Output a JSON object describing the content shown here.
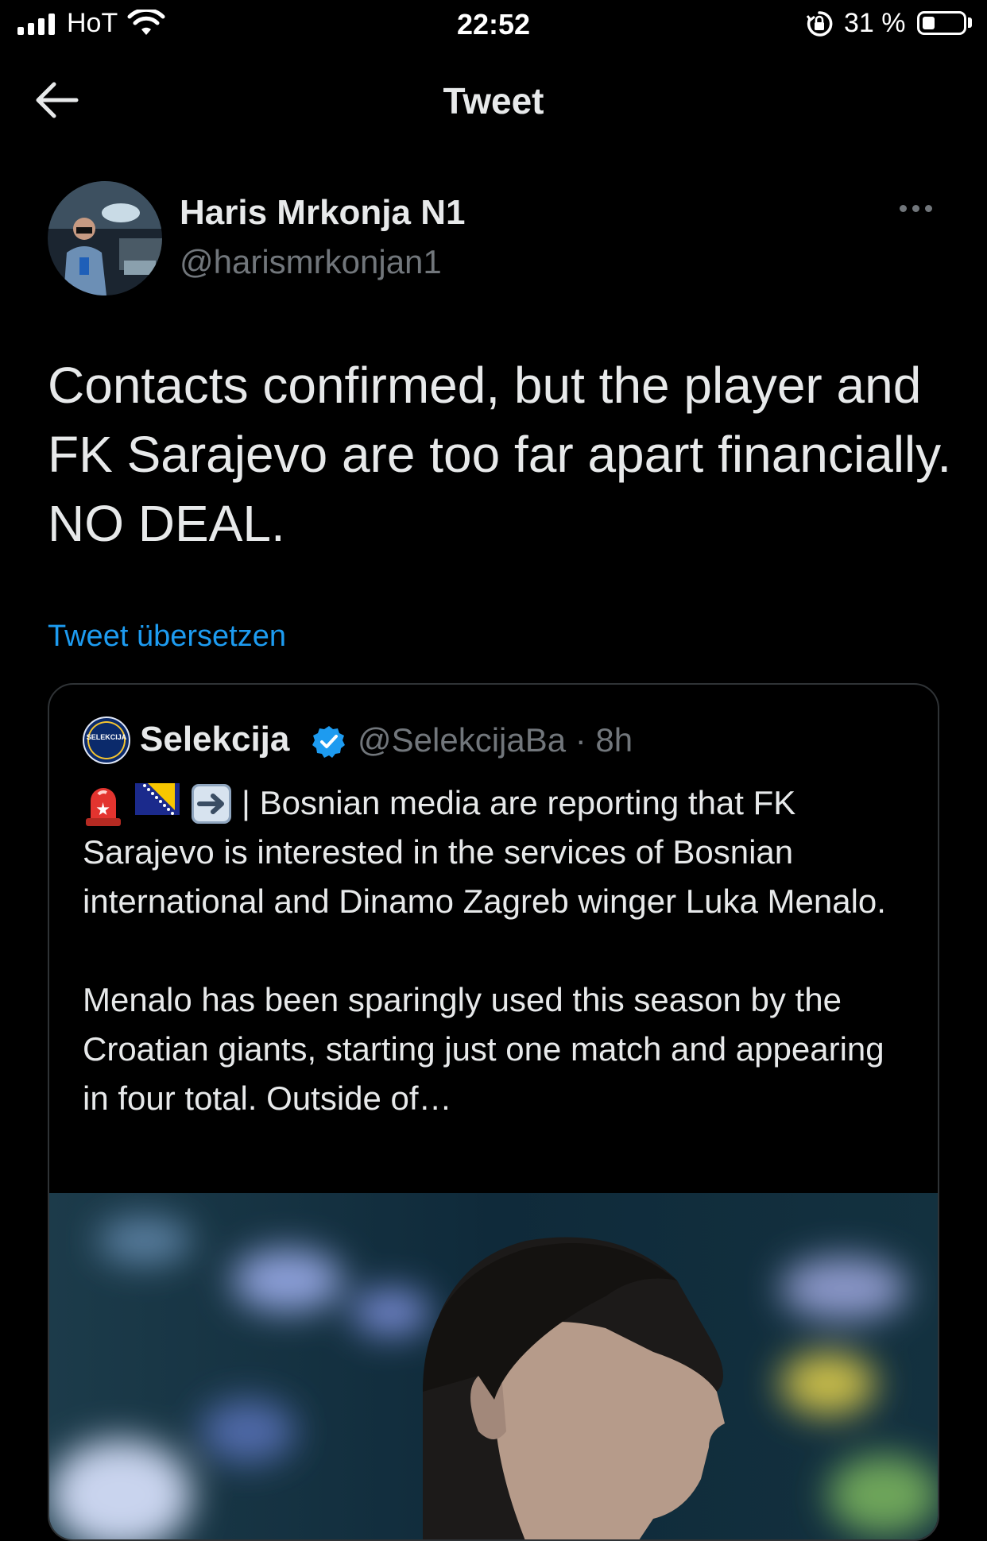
{
  "status_bar": {
    "carrier": "HoT",
    "time": "22:52",
    "battery_percent": "31 %",
    "battery_level": 0.31
  },
  "header": {
    "title": "Tweet"
  },
  "tweet": {
    "author_name": "Haris Mrkonja N1",
    "author_handle": "@harismrkonjan1",
    "text": "Contacts confirmed, but the player and FK Sarajevo are too far apart financially. NO DEAL.",
    "translate_link": "Tweet übersetzen"
  },
  "quoted_tweet": {
    "author_name": "Selekcija",
    "author_handle": "@SelekcijaBa · 8h",
    "avatar_text": "SELEKCIJA",
    "paragraph1": "| Bosnian media are reporting that FK Sarajevo is interested in the services of Bosnian international and Dinamo Zagreb winger Luka Menalo.",
    "paragraph2": "Menalo has been sparingly used this season by the Croatian giants, starting just one match and appearing in four total. Outside of…",
    "emojis": [
      "siren-emoji",
      "bosnia-flag-emoji",
      "right-arrow-emoji"
    ]
  },
  "colors": {
    "background": "#000000",
    "text": "#e7e9ea",
    "muted": "#71767b",
    "link": "#1d9bf0",
    "border": "#2f3336"
  }
}
